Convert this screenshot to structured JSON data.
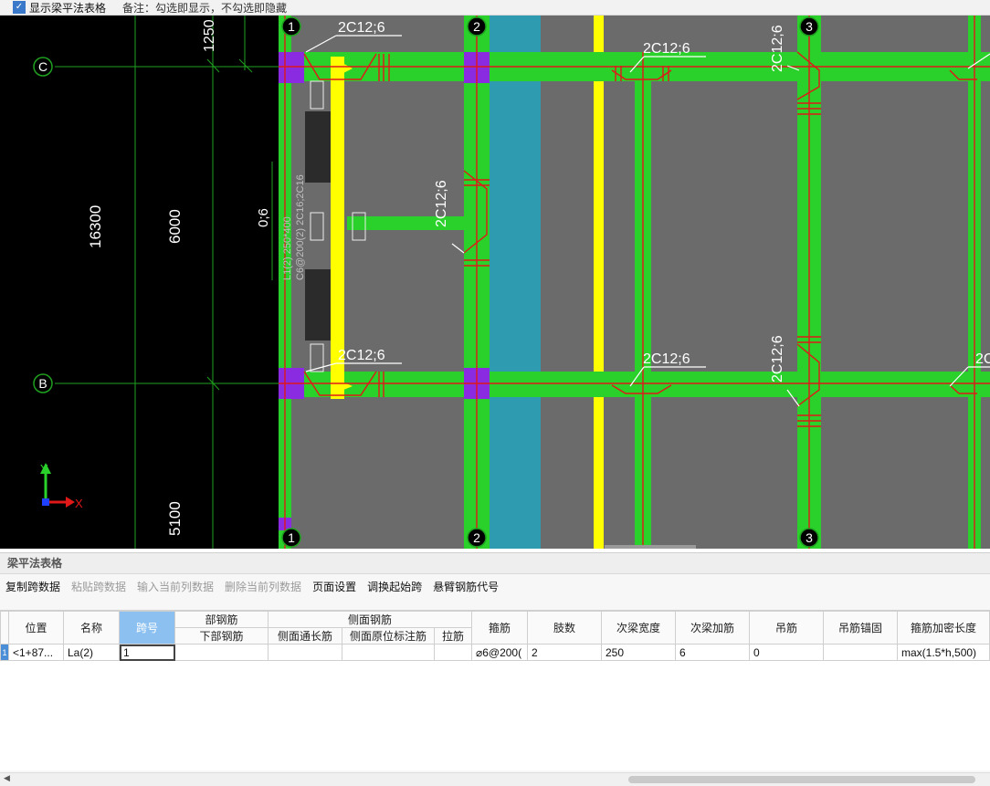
{
  "topbar": {
    "checkbox_checked": true,
    "checkbox_label": "显示梁平法表格",
    "note": "备注：勾选即显示，不勾选即隐藏"
  },
  "canvas": {
    "axis_labels": {
      "col_1_top": "1",
      "col_2_top": "2",
      "col_3_top": "3",
      "col_1_bottom": "1",
      "col_2_bottom": "2",
      "col_3_bottom": "3",
      "row_c": "C",
      "row_b": "B"
    },
    "dimensions": {
      "d1250": "1250",
      "d16300": "16300",
      "d6000": "6000",
      "d5100": "5100",
      "d06": "0;6"
    },
    "rebar_labels": {
      "top_left": "2C12;6",
      "top_mid": "2C12;6",
      "vert_mid": "2C12;6",
      "vert_right_top": "2C12;6",
      "bottom_left": "2C12;6",
      "bottom_mid": "2C12;6",
      "vert_right_bottom": "2C12;6",
      "bottom_edge": "2C",
      "beam_annot_1": "C6@200(2) 2C16;2C16",
      "beam_annot_2": "L1(2) 250*400"
    },
    "ucs": {
      "y": "Y",
      "x": "X"
    },
    "colors": {
      "beam": "#2ad12a",
      "column": "#8a2be2",
      "slab": "#6b6b6b",
      "highlight": "#ffff00",
      "rebar": "#e01818",
      "wall": "#2e9bb0",
      "axis": "#1fa01f"
    }
  },
  "panel": {
    "title": "梁平法表格",
    "toolbar": {
      "copy": "复制跨数据",
      "paste": "粘贴跨数据",
      "input_col": "输入当前列数据",
      "delete_col": "删除当前列数据",
      "page_setup": "页面设置",
      "swap_start": "调换起始跨",
      "cantilever": "悬臂钢筋代号"
    },
    "table": {
      "headers": {
        "position": "位置",
        "name": "名称",
        "span_no": "跨号",
        "bottom_group": "部钢筋",
        "bottom_rebar": "下部钢筋",
        "side_group": "侧面钢筋",
        "side_through": "侧面通长筋",
        "side_original": "侧面原位标注筋",
        "tie": "拉筋",
        "stirrup": "箍筋",
        "legs": "肢数",
        "sec_width": "次梁宽度",
        "sec_add": "次梁加筋",
        "hanger": "吊筋",
        "hanger_anchor": "吊筋锚固",
        "dense_len": "箍筋加密长度"
      },
      "row": {
        "index": "1",
        "position": "<1+87...",
        "name": "La(2)",
        "span_no": "1",
        "bottom_rebar": "",
        "side_through": "",
        "side_original": "",
        "tie": "",
        "stirrup": "⌀6@200(",
        "legs": "2",
        "sec_width": "250",
        "sec_add": "6",
        "hanger": "0",
        "hanger_anchor": "",
        "dense_len": "max(1.5*h,500)"
      }
    }
  }
}
